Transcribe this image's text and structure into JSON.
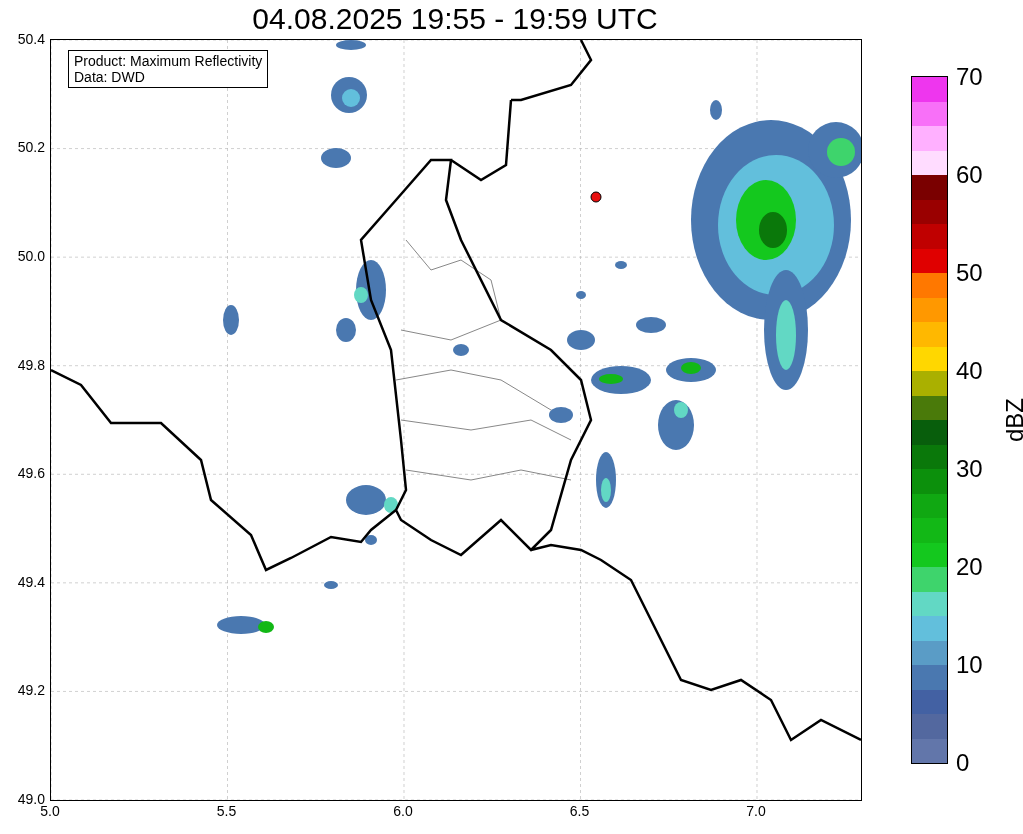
{
  "title": "04.08.2025 19:55 - 19:59 UTC",
  "legend": {
    "lines": [
      "Product: Maximum Reflectivity",
      "Data: DWD"
    ]
  },
  "map": {
    "xticks": [
      "5.0",
      "5.5",
      "6.0",
      "6.5",
      "7.0"
    ],
    "yticks": [
      "50.4",
      "50.2",
      "50.0",
      "49.8",
      "49.6",
      "49.4",
      "49.2",
      "49.0"
    ]
  },
  "colorbar": {
    "label": "dBZ",
    "ticks": [
      "70",
      "60",
      "50",
      "40",
      "30",
      "20",
      "10",
      "0"
    ],
    "segments": [
      {
        "color": "#ee36ee"
      },
      {
        "color": "#f870f8"
      },
      {
        "color": "#ffb0ff"
      },
      {
        "color": "#ffdcff"
      },
      {
        "color": "#7a0000"
      },
      {
        "color": "#9a0000"
      },
      {
        "color": "#c00000"
      },
      {
        "color": "#e00000"
      },
      {
        "color": "#ff7800"
      },
      {
        "color": "#ff9800"
      },
      {
        "color": "#ffb800"
      },
      {
        "color": "#ffd700"
      },
      {
        "color": "#aab000"
      },
      {
        "color": "#4a7a0a"
      },
      {
        "color": "#085e0c"
      },
      {
        "color": "#0a780a"
      },
      {
        "color": "#0c900c"
      },
      {
        "color": "#10a812"
      },
      {
        "color": "#12b816"
      },
      {
        "color": "#14c81e"
      },
      {
        "color": "#3ed46c"
      },
      {
        "color": "#62d8c4"
      },
      {
        "color": "#62bfdc"
      },
      {
        "color": "#5a9cc6"
      },
      {
        "color": "#4a78b0"
      },
      {
        "color": "#4361a3"
      },
      {
        "color": "#53689f"
      },
      {
        "color": "#6276aa"
      }
    ]
  }
}
